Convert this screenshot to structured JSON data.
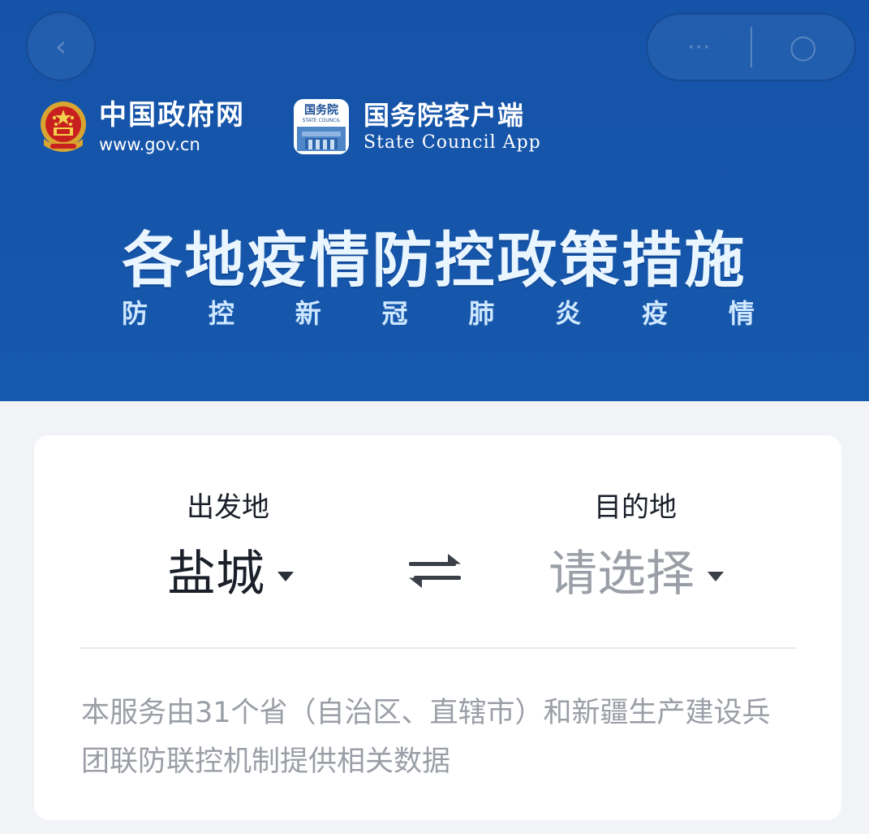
{
  "nav": {
    "back_icon": "back-icon",
    "menu_icon": "more-dots-icon",
    "close_icon": "close-circle-icon"
  },
  "header": {
    "gov_logo": {
      "name": "中国政府网",
      "url_text": "www.gov.cn",
      "icon": "national-emblem-icon"
    },
    "app_logo": {
      "name": "国务院客户端",
      "english": "State Council App",
      "icon_text": "国务院",
      "icon_small": "STATE COUNCIL"
    },
    "title": "各地疫情防控政策措施",
    "subtitle_chars": [
      "防",
      "控",
      "新",
      "冠",
      "肺",
      "炎",
      "疫",
      "情"
    ]
  },
  "route": {
    "origin_label": "出发地",
    "origin_value": "盐城",
    "destination_label": "目的地",
    "destination_value": "请选择",
    "swap_icon": "swap-arrows-icon"
  },
  "notice": "本服务由31个省（自治区、直辖市）和新疆生产建设兵团联防联控机制提供相关数据",
  "colors": {
    "header_blue": "#1553a8",
    "page_bg": "#f1f3f7",
    "selected_text": "#1a1f29",
    "placeholder_text": "#9a9ea6"
  }
}
